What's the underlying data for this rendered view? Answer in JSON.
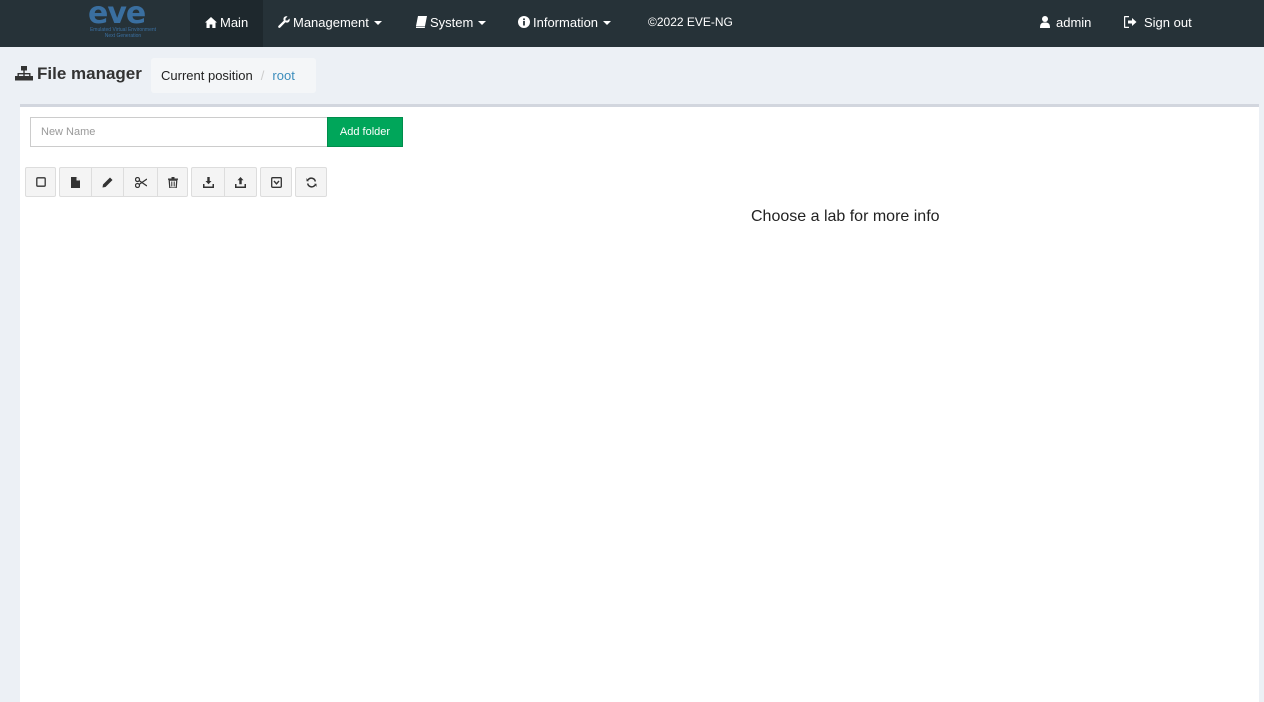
{
  "brand": {
    "logo_text": "eve",
    "tagline_1": "Emulated Virtual Environment",
    "tagline_2": "Next Generation"
  },
  "navbar": {
    "main": "Main",
    "management": "Management",
    "system": "System",
    "information": "Information",
    "copyright": "©2022 EVE-NG",
    "user": "admin",
    "sign_out": "Sign out"
  },
  "header": {
    "title": "File manager",
    "breadcrumb_label": "Current position",
    "breadcrumb_current": "root"
  },
  "folder_form": {
    "placeholder": "New Name",
    "add_button": "Add folder"
  },
  "toolbar": {
    "icons": [
      "checkbox-icon",
      "new-file-icon",
      "rename-icon",
      "cut-icon",
      "delete-icon",
      "import-icon",
      "export-icon",
      "move-icon",
      "refresh-icon"
    ]
  },
  "info_panel": {
    "text": "Choose a lab for more info"
  },
  "colors": {
    "navbar": "#263238",
    "navbar_active": "#1e282d",
    "add_button": "#00a65a",
    "link": "#3c8dbc",
    "background": "#ecf0f5"
  }
}
